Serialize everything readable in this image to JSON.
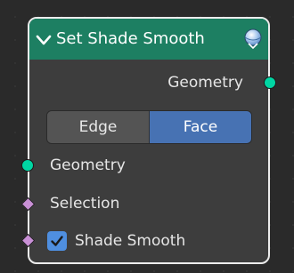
{
  "node": {
    "title": "Set Shade Smooth",
    "header_color": "#1d7f62",
    "body_color": "#3d3d3d",
    "collapse_icon": "chevron-down-icon",
    "preview_icon": "sphere-icon",
    "outputs": [
      {
        "label": "Geometry",
        "socket_type": "geometry",
        "socket_color": "#00d6a3"
      }
    ],
    "domain": {
      "options": [
        "Edge",
        "Face"
      ],
      "selected": "Face",
      "selected_color": "#4772b3"
    },
    "inputs": [
      {
        "label": "Geometry",
        "socket_type": "geometry",
        "socket_color": "#00d6a3"
      },
      {
        "label": "Selection",
        "socket_type": "boolean-field",
        "socket_color": "#c990d6"
      }
    ],
    "shade_smooth": {
      "label": "Shade Smooth",
      "checked": true,
      "socket_type": "boolean-field",
      "socket_color": "#c990d6",
      "checkbox_color": "#4f8fe0"
    }
  }
}
